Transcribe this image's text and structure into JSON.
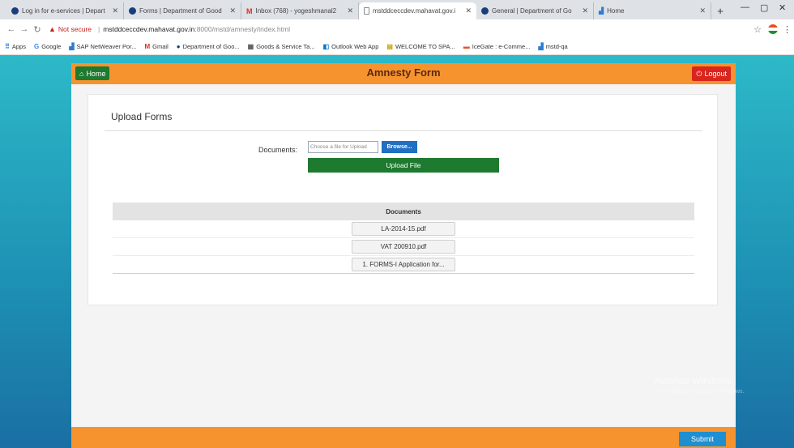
{
  "browser": {
    "tabs": [
      {
        "title": "Log in for e-services | Depart",
        "icon": "globe-icon"
      },
      {
        "title": "Forms | Department of Good",
        "icon": "globe-icon"
      },
      {
        "title": "Inbox (768) - yogeshmanal2",
        "icon": "gmail-icon"
      },
      {
        "title": "mstddceccdev.mahavat.gov.i",
        "icon": "page-icon"
      },
      {
        "title": "General | Department of Go",
        "icon": "globe-icon"
      },
      {
        "title": "Home",
        "icon": "bar-chart-icon"
      }
    ],
    "address": {
      "not_secure": "Not secure",
      "host": "mstddceccdev.mahavat.gov.in",
      "path": ":8000/mstd/amnesty/index.html"
    },
    "bookmarks": [
      {
        "label": "Apps",
        "icon": "apps-grid-icon"
      },
      {
        "label": "Google",
        "icon": "google-icon"
      },
      {
        "label": "SAP NetWeaver Por...",
        "icon": "bar-chart-icon"
      },
      {
        "label": "Gmail",
        "icon": "gmail-icon"
      },
      {
        "label": "Department of Goo...",
        "icon": "globe-icon"
      },
      {
        "label": "Goods & Service Ta...",
        "icon": "building-icon"
      },
      {
        "label": "Outlook Web App",
        "icon": "outlook-icon"
      },
      {
        "label": "WELCOME TO SPA...",
        "icon": "spa-icon"
      },
      {
        "label": "IceGate : e-Comme...",
        "icon": "flag-icon"
      },
      {
        "label": "mstd-qa",
        "icon": "bar-chart-icon"
      }
    ]
  },
  "app": {
    "home_label": "Home",
    "title": "Amnesty Form",
    "logout_label": "Logout",
    "card_title": "Upload Forms",
    "documents_label": "Documents:",
    "file_placeholder": "Choose a file for Upload",
    "browse_label": "Browse...",
    "upload_label": "Upload File",
    "table_header": "Documents",
    "files": [
      "LA-2014-15.pdf",
      "VAT 200910.pdf",
      "1. FORMS-I Application for..."
    ],
    "submit_label": "Submit",
    "watermark": "Activate Windows",
    "watermark_sub": "Go to Settings to activate Windows."
  },
  "colors": {
    "header_orange": "#f7932e",
    "home_green": "#1e7a2f",
    "logout_red": "#d9261c",
    "browse_blue": "#1f6fc2",
    "submit_blue": "#1f8fcf"
  }
}
